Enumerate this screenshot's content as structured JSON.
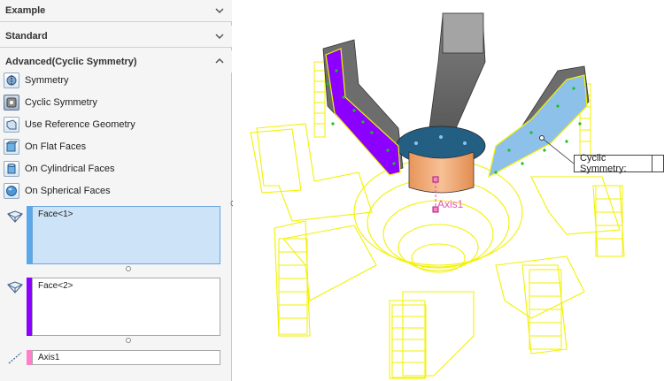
{
  "sections": {
    "example": "Example",
    "standard": "Standard",
    "advanced": "Advanced(Cyclic Symmetry)"
  },
  "options": [
    {
      "label": "Symmetry",
      "icon": "symmetry-icon"
    },
    {
      "label": "Cyclic Symmetry",
      "icon": "cyclic-symmetry-icon"
    },
    {
      "label": "Use Reference Geometry",
      "icon": "reference-geometry-icon"
    },
    {
      "label": "On Flat Faces",
      "icon": "flat-faces-icon"
    },
    {
      "label": "On Cylindrical Faces",
      "icon": "cylindrical-faces-icon"
    },
    {
      "label": "On Spherical Faces",
      "icon": "spherical-faces-icon"
    }
  ],
  "selected_option": "Cyclic Symmetry",
  "selections": {
    "face1": "Face<1>",
    "face2": "Face<2>",
    "axis": "Axis1"
  },
  "colors": {
    "face1": "#5aa7ea",
    "face2": "#8b00ff",
    "axis": "#ff7fc8",
    "wireframe": "#ffff00",
    "model": "#6e6e6e",
    "copper": "#f2a86b"
  },
  "viewport": {
    "axis_label": "Axis1",
    "callout": "Cyclic Symmetry:"
  }
}
